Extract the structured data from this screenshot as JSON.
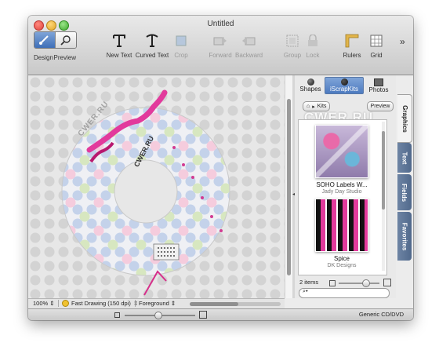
{
  "window": {
    "title": "Untitled"
  },
  "toolbar": {
    "design": "Design",
    "preview": "Preview",
    "new_text": "New Text",
    "curved_text": "Curved Text",
    "crop": "Crop",
    "forward": "Forward",
    "backward": "Backward",
    "group": "Group",
    "lock": "Lock",
    "rulers": "Rulers",
    "grid": "Grid",
    "overflow": "»"
  },
  "canvas": {
    "watermark": "CWER.RU",
    "disc_text": "CWER.RU"
  },
  "status": {
    "zoom": "100%",
    "drawing_mode": "Fast Drawing (150 dpi)",
    "layer": "Foreground"
  },
  "bottom": {
    "media_type": "Generic CD/DVD"
  },
  "inspector": {
    "tabs": [
      "Shapes",
      "iScrapKits",
      "Photos"
    ],
    "active_tab": "iScrapKits",
    "breadcrumb": "Kits",
    "preview_button": "Preview",
    "watermark": "CWER.RU",
    "items": [
      {
        "title": "SOHO Labels W...",
        "author": "Jady Day Studio"
      },
      {
        "title": "Spice",
        "author": "DK Designs"
      }
    ],
    "count_label": "2 items",
    "search_placeholder": ""
  },
  "side_tabs": [
    "Graphics",
    "Text",
    "Fields",
    "Favorites"
  ],
  "colors": {
    "accent": "#3e6fb8",
    "side_tab": "#5a7296",
    "pink": "#e23a9c",
    "canvas_bg": "#e7e7e7"
  }
}
